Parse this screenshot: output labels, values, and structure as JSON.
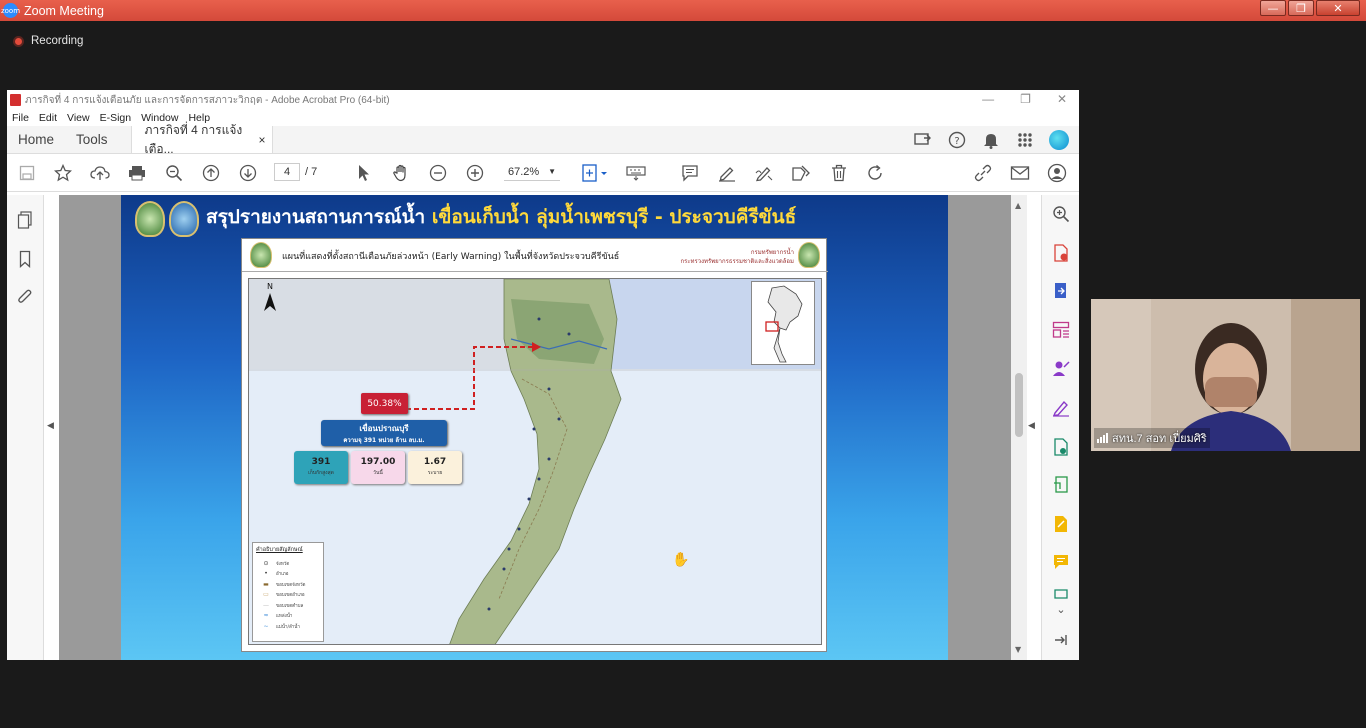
{
  "zoom": {
    "title": "Zoom Meeting",
    "logo_text": "zoom",
    "recording_label": "Recording",
    "window_buttons": [
      "—",
      "❐",
      "✕"
    ]
  },
  "acrobat": {
    "window_title": "ภารกิจที่ 4 การแจ้งเตือนภัย และการจัดการสภาวะวิกฤต - Adobe Acrobat Pro (64-bit)",
    "window_controls": [
      "—",
      "❐",
      "✕"
    ],
    "menu": [
      "File",
      "Edit",
      "View",
      "E-Sign",
      "Window",
      "Help"
    ],
    "tabs": {
      "home": "Home",
      "tools": "Tools",
      "doc": "ภารกิจที่ 4 การแจ้งเตือ...",
      "doc_close": "×"
    },
    "toolbar": {
      "current_page": "4",
      "total_pages": "/ 7",
      "zoom": "67.2%"
    }
  },
  "slide": {
    "title_prefix": "สรุปรายงานสถานการณ์น้ำ",
    "title_highlight": "เขื่อนเก็บน้ำ ลุ่มน้ำเพชรบุรี - ประจวบคีรีขันธ์",
    "map": {
      "header_title": "แผนที่แสดงที่ตั้งสถานีเตือนภัยล่วงหน้า (Early Warning) ในพื้นที่จังหวัดประจวบคีรีขันธ์",
      "org_line1": "กรมทรัพยากรน้ำ",
      "org_line2": "กระทรวงทรัพยากรธรรมชาติและสิ่งแวดล้อม",
      "north": "N",
      "percent": "50.38%",
      "dam_name": "เขื่อนปราณบุรี",
      "dam_capacity": "ความจุ 391 หน่วย ล้าน ลบ.ม.",
      "stats": [
        {
          "value": "391",
          "label": "เก็บกักสูงสุด",
          "color": "#2ea3b8"
        },
        {
          "value": "197.00",
          "label": "วันนี้",
          "color": "#f7d8ea"
        },
        {
          "value": "1.67",
          "label": "ระบาย",
          "color": "#fbf1dc"
        }
      ],
      "legend_title": "คำอธิบายสัญลักษณ์",
      "legend_items": [
        "จังหวัด",
        "อำเภอ",
        "ขอบเขตจังหวัด",
        "ขอบเขตอำเภอ",
        "ขอบเขตตำบล",
        "แหล่งน้ำ",
        "แม่น้ำ/ลำน้ำ"
      ]
    }
  },
  "video": {
    "participant_name": "สทน.7 สอท เปี่ยมศิริ"
  }
}
